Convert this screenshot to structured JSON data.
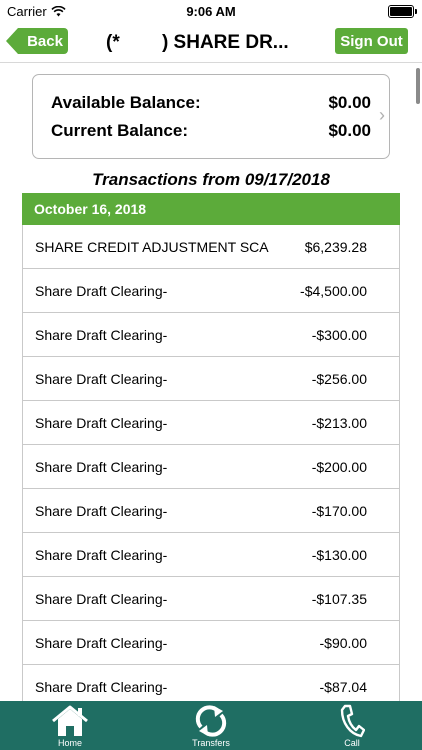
{
  "status_bar": {
    "carrier": "Carrier",
    "time": "9:06 AM"
  },
  "nav": {
    "back_label": "Back",
    "title": "(*        ) SHARE DR...",
    "signout_label": "Sign Out"
  },
  "balances": [
    {
      "label": "Available Balance:",
      "value": "$0.00"
    },
    {
      "label": "Current Balance:",
      "value": "$0.00"
    }
  ],
  "transactions_header": "Transactions from 09/17/2018",
  "date_group": "October 16, 2018",
  "transactions": [
    {
      "desc": "SHARE CREDIT ADJUSTMENT SCA",
      "amount": "$6,239.28"
    },
    {
      "desc": "Share Draft Clearing-",
      "amount": "-$4,500.00"
    },
    {
      "desc": "Share Draft Clearing-",
      "amount": "-$300.00"
    },
    {
      "desc": "Share Draft Clearing-",
      "amount": "-$256.00"
    },
    {
      "desc": "Share Draft Clearing-",
      "amount": "-$213.00"
    },
    {
      "desc": "Share Draft Clearing-",
      "amount": "-$200.00"
    },
    {
      "desc": "Share Draft Clearing-",
      "amount": "-$170.00"
    },
    {
      "desc": "Share Draft Clearing-",
      "amount": "-$130.00"
    },
    {
      "desc": "Share Draft Clearing-",
      "amount": "-$107.35"
    },
    {
      "desc": "Share Draft Clearing-",
      "amount": "-$90.00"
    },
    {
      "desc": "Share Draft Clearing-",
      "amount": "-$87.04"
    }
  ],
  "tabs": [
    {
      "label": "Home",
      "icon": "home-icon"
    },
    {
      "label": "Transfers",
      "icon": "transfers-icon"
    },
    {
      "label": "Call",
      "icon": "phone-icon"
    }
  ],
  "colors": {
    "accent_green": "#5cab3a",
    "tab_bar": "#1f6e63"
  }
}
